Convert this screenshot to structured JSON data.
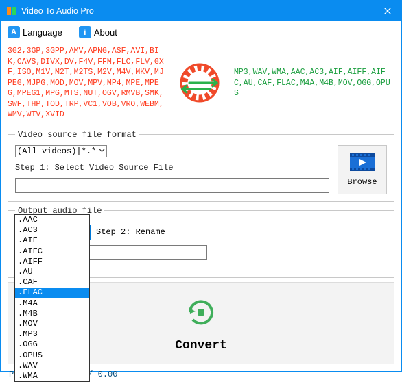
{
  "window": {
    "title": "Video To Audio Pro"
  },
  "menu": {
    "language": "Language",
    "about": "About"
  },
  "formats": {
    "input": "3G2,3GP,3GPP,AMV,APNG,ASF,AVI,BIK,CAVS,DIVX,DV,F4V,FFM,FLC,FLV,GXF,ISO,M1V,M2T,M2TS,M2V,M4V,MKV,MJPEG,MJPG,MOD,MOV,MPV,MP4,MPE,MPEG,MPEG1,MPG,MTS,NUT,OGV,RMVB,SMK,SWF,THP,TOD,TRP,VC1,VOB,VRO,WEBM,WMV,WTV,XVID",
    "output": "MP3,WAV,WMA,AAC,AC3,AIF,AIFF,AIFC,AU,CAF,FLAC,M4A,M4B,MOV,OGG,OPUS"
  },
  "source": {
    "legend": "Video source file format",
    "filter": "(All videos)|*.*",
    "step1": "Step 1: Select Video Source File",
    "browse": "Browse"
  },
  "output": {
    "legend": "Output audio file",
    "selected": ".AAC",
    "step2": "Step 2: Rename",
    "options": [
      ".AAC",
      ".AC3",
      ".AIF",
      ".AIFC",
      ".AIFF",
      ".AU",
      ".CAF",
      ".FLAC",
      ".M4A",
      ".M4B",
      ".MOV",
      ".MP3",
      ".OGG",
      ".OPUS",
      ".WAV",
      ".WMA"
    ],
    "highlighted": ".FLAC"
  },
  "convert": {
    "label": "Convert"
  },
  "progress": {
    "text": "Progress : 0.00 / 0.00"
  }
}
